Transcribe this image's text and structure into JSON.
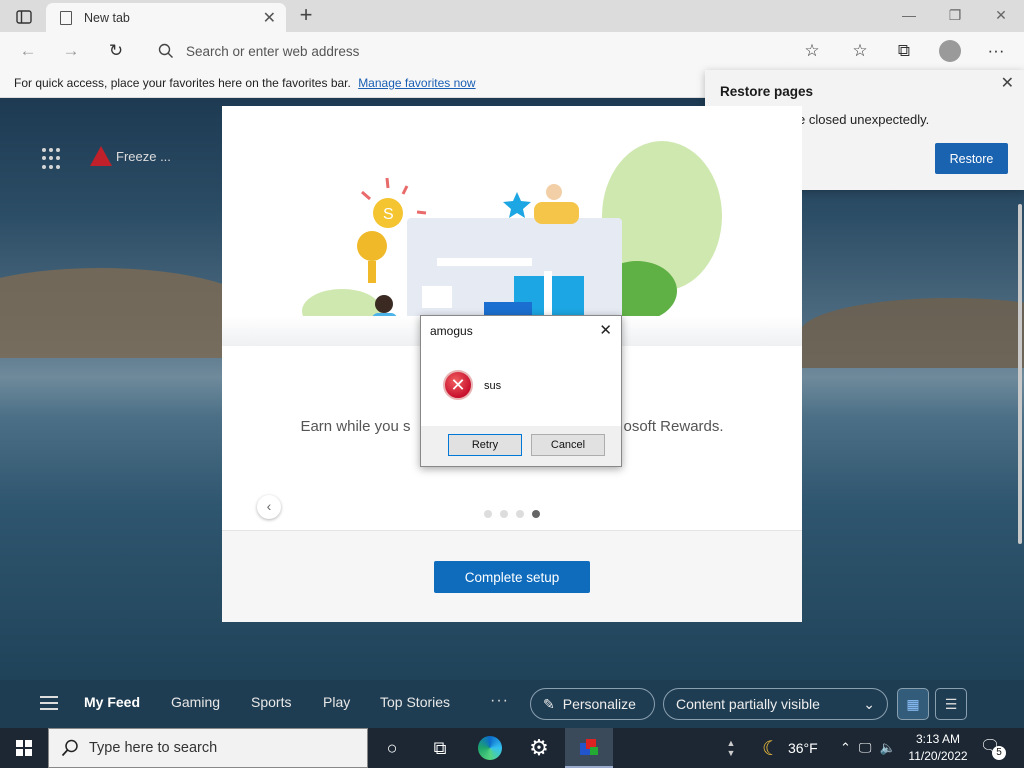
{
  "browser": {
    "tab_title": "New tab",
    "address_placeholder": "Search or enter web address",
    "favorites_bar_text": "For quick access, place your favorites here on the favorites bar.",
    "favorites_link": "Manage favorites now"
  },
  "page": {
    "weather_chip": "Freeze ..."
  },
  "restore_flyout": {
    "title": "Restore pages",
    "message": "e closed unexpectedly.",
    "button": "Restore"
  },
  "setup_dialog": {
    "tagline": "Earn while you s",
    "tagline_end": "osoft Rewards.",
    "cta": "Complete setup",
    "dots_total": 4,
    "dots_active_index": 3
  },
  "message_box": {
    "title": "amogus",
    "message": "sus",
    "retry": "Retry",
    "cancel": "Cancel"
  },
  "news_bar": {
    "tabs": [
      "My Feed",
      "Gaming",
      "Sports",
      "Play",
      "Top Stories"
    ],
    "more": "···",
    "personalize": "Personalize",
    "content_visibility": "Content partially visible"
  },
  "taskbar": {
    "search_placeholder": "Type here to search",
    "temperature": "36°F",
    "time": "3:13 AM",
    "date": "11/20/2022",
    "notification_count": "5"
  },
  "colors": {
    "accent": "#0f6cbd",
    "restore_button": "#1a63b0",
    "taskbar": "#1c2733"
  }
}
